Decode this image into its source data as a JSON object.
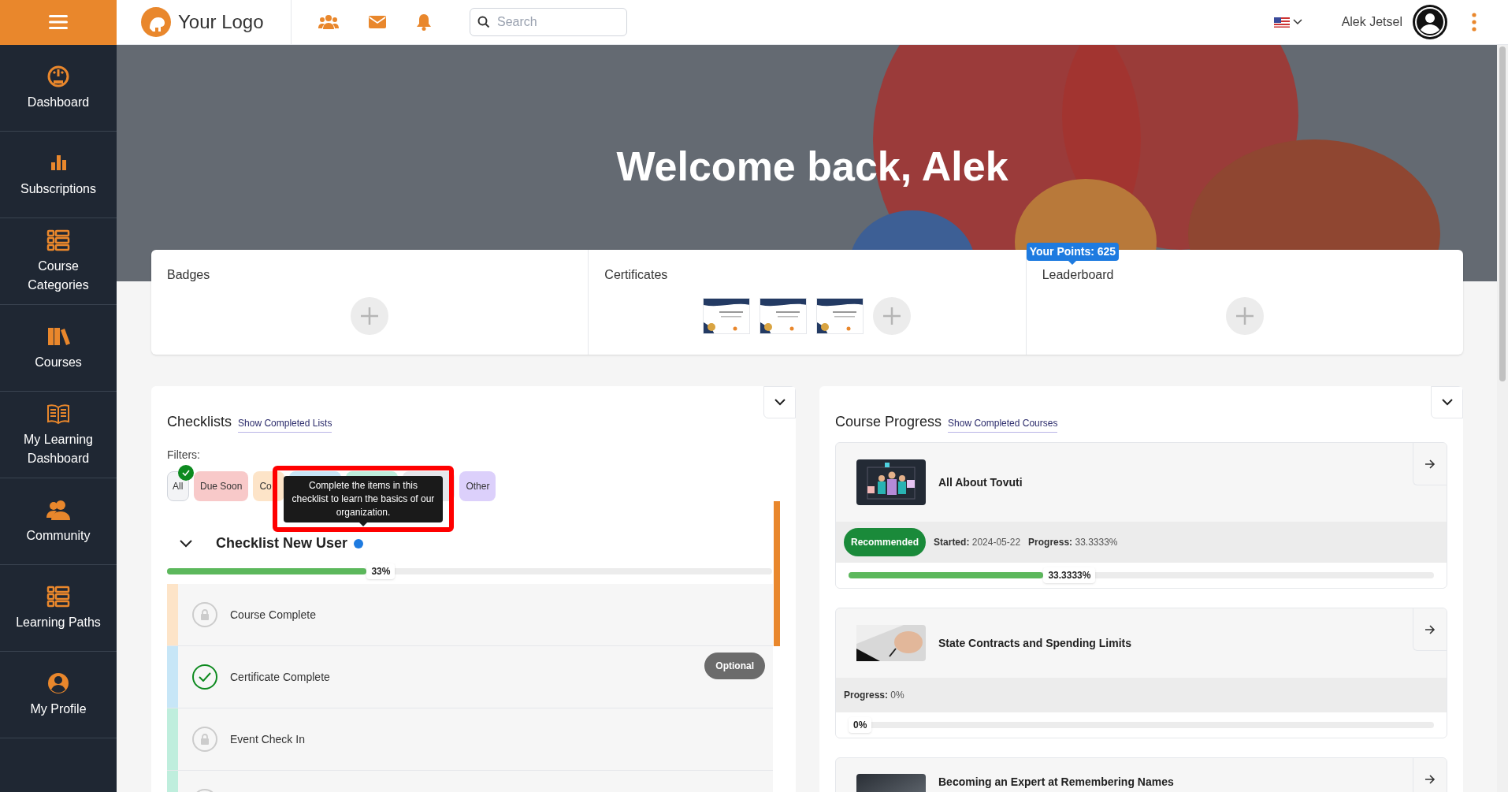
{
  "topbar": {
    "logo_text": "Your Logo",
    "search": {
      "placeholder": "Search"
    },
    "user_name": "Alek Jetsel"
  },
  "sidebar": {
    "items": [
      {
        "label": "Dashboard",
        "kind": "gauge"
      },
      {
        "label": "Subscriptions",
        "kind": "bars"
      },
      {
        "label": "Course Categories",
        "kind": "list"
      },
      {
        "label": "Courses",
        "kind": "books"
      },
      {
        "label": "My Learning Dashboard",
        "kind": "book"
      },
      {
        "label": "Community",
        "kind": "users"
      },
      {
        "label": "Learning Paths",
        "kind": "list"
      },
      {
        "label": "My Profile",
        "kind": "user"
      }
    ]
  },
  "hero": {
    "title": "Welcome back, Alek"
  },
  "summary": {
    "sections": [
      {
        "title": "Badges",
        "kind": "badges"
      },
      {
        "title": "Certificates",
        "kind": "certificates"
      },
      {
        "title": "Leaderboard",
        "kind": "leaderboard",
        "points_badge": "Your Points: 625"
      }
    ]
  },
  "checklists": {
    "title": "Checklists",
    "link": "Show Completed Lists",
    "filters_label": "Filters:",
    "filters": [
      {
        "label": "All",
        "color": "#f3f4f6",
        "selected": true
      },
      {
        "label": "Due Soon",
        "color": "#f8c9c9",
        "selected": false
      },
      {
        "label": "Co",
        "color": "#fde4c8",
        "selected": false
      },
      {
        "color": "#c7e6f7",
        "selected": false
      },
      {
        "color": "#bfeedd",
        "selected": false
      },
      {
        "color": "#e5e7eb",
        "selected": false
      },
      {
        "label": "Other",
        "color": "#dcd0fb",
        "selected": false
      }
    ],
    "tooltip": "Complete the items in this checklist to learn the basics of our organization.",
    "checklist": {
      "title": "Checklist New User",
      "expanded": true,
      "level": 0.33,
      "reading": "33%",
      "items": [
        {
          "label": "Course Complete",
          "completed": false,
          "color": "#fde4c8"
        },
        {
          "label": "Certificate Complete",
          "completed": true,
          "color": "#c7e6f7",
          "badge": "Optional"
        },
        {
          "label": "Event Check In",
          "completed": false,
          "color": "#bfeedd"
        },
        {
          "completed": false,
          "color": "#bfeedd"
        }
      ]
    }
  },
  "course_progress": {
    "title": "Course Progress",
    "link": "Show Completed Courses",
    "courses": [
      {
        "title": "All About Tovuti",
        "tag": "Recommended",
        "meta": [
          "**Started:** 2024-05-22",
          "**Progress:** 33.3333%"
        ],
        "level": 0.333,
        "reading": "33.3333%"
      },
      {
        "title": "State Contracts and Spending Limits",
        "meta": [
          "**Progress:** 0%"
        ],
        "level": 0,
        "reading": "0%"
      },
      {
        "title": "Becoming an Expert at Remembering Names"
      }
    ]
  }
}
